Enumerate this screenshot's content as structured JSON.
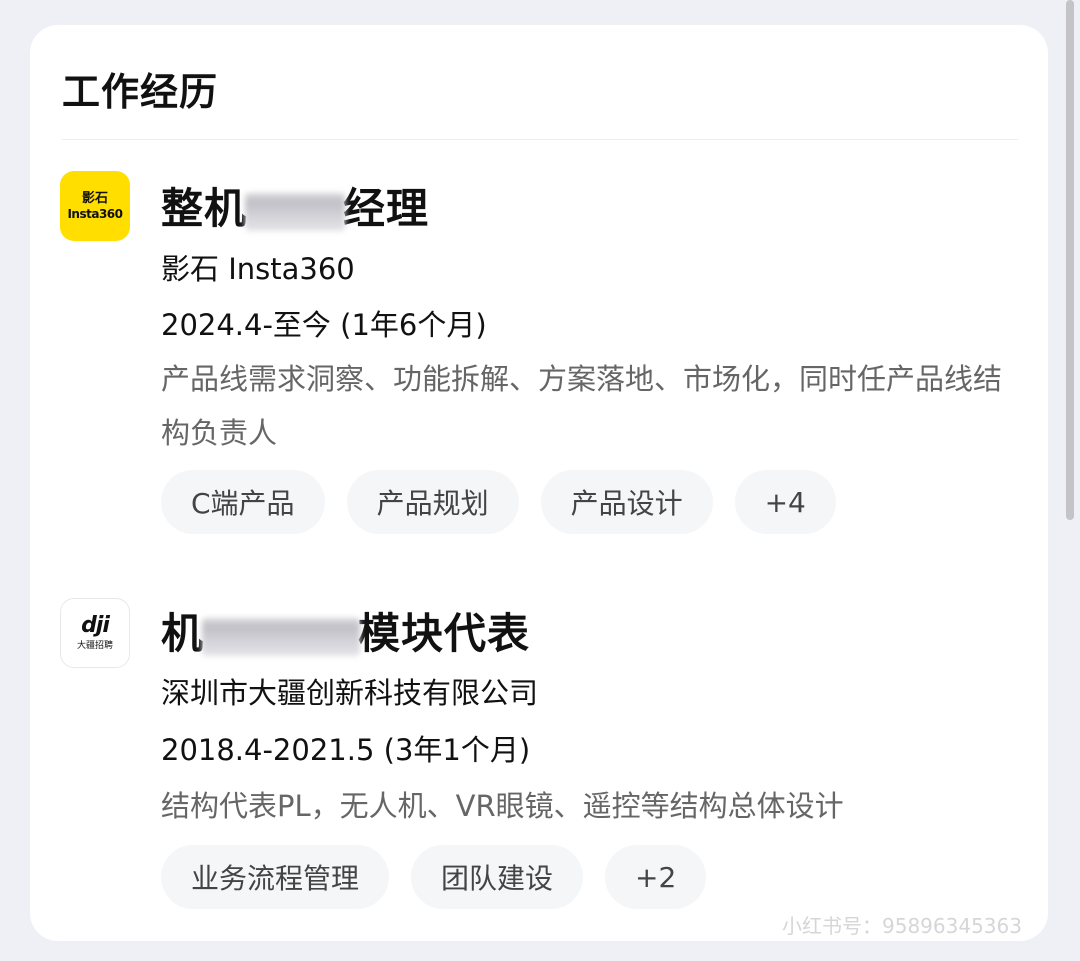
{
  "section": {
    "title": "工作经历"
  },
  "jobs": [
    {
      "logo_line1": "影石",
      "logo_line2": "Insta360",
      "title_start": "整机",
      "title_end": "经理",
      "company": "影石 Insta360",
      "period": "2024.4-至今  (1年6个月)",
      "description": "产品线需求洞察、功能拆解、方案落地、市场化，同时任产品线结构负责人",
      "tags": [
        "C端产品",
        "产品规划",
        "产品设计",
        "+4"
      ]
    },
    {
      "logo_line1": "dji",
      "logo_line2": "大疆招聘",
      "title_start": "机",
      "title_end": "模块代表",
      "company": "深圳市大疆创新科技有限公司",
      "period": "2018.4-2021.5  (3年1个月)",
      "description": "结构代表PL，无人机、VR眼镜、遥控等结构总体设计",
      "tags": [
        "业务流程管理",
        "团队建设",
        "+2"
      ]
    }
  ],
  "watermark": "小红书号：95896345363",
  "colors": {
    "background": "#eef0f5",
    "card": "#ffffff",
    "insta_logo": "#ffde00",
    "tag_bg": "#f5f6f8",
    "desc_text": "#666666"
  }
}
